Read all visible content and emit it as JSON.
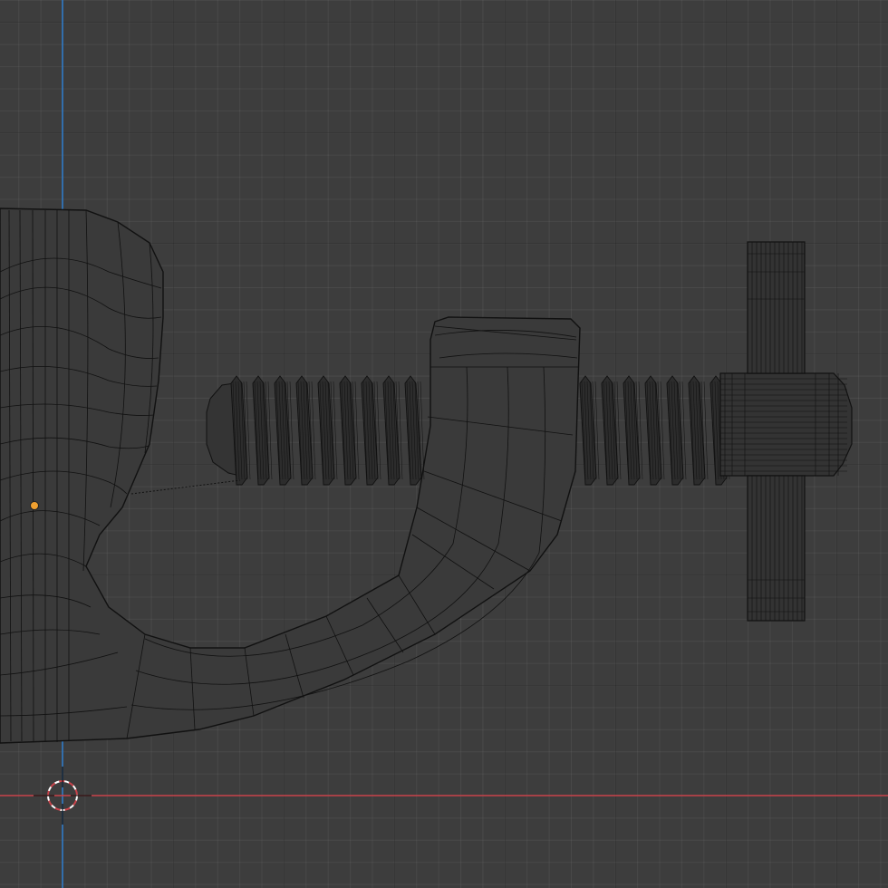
{
  "viewport": {
    "background": "#3d3d3d",
    "x_axis_color": "#c9434b",
    "y_axis_color": "#2f7fd0",
    "mesh_fill": "#3a3a3a",
    "wire_color": "#111111",
    "origin_color": "#f0a030"
  },
  "scene": {
    "object": "c-clamp",
    "parts": [
      "clamp-frame",
      "threaded-screw",
      "screw-swivel-pad",
      "t-handle"
    ],
    "display_mode": "wireframe"
  },
  "icons": {
    "cursor": "3d-cursor-icon",
    "origin": "object-origin-dot"
  }
}
